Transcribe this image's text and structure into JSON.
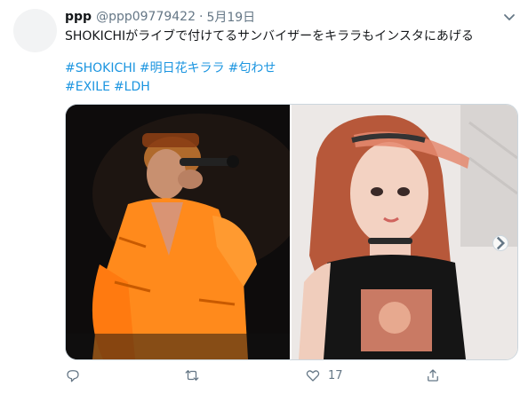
{
  "tweet": {
    "name": "ppp",
    "handle": "@ppp09779422",
    "separator": "·",
    "date": "5月19日",
    "text": "SHOKICHIがライブで付けてるサンバイザーをキララもインスタにあげる",
    "hashtags": [
      "#SHOKICHI",
      "#明日花キララ",
      "#匂わせ",
      "#EXILE",
      "#LDH"
    ]
  },
  "actions": {
    "reply_count": "",
    "retweet_count": "",
    "like_count": "17",
    "share_count": ""
  },
  "icons": [
    "caret-down-icon",
    "reply-icon",
    "retweet-icon",
    "like-icon",
    "share-icon",
    "chevron-right-icon"
  ],
  "colors": {
    "link": "#1b95e0",
    "secondary": "#657786",
    "border": "#ccd6dd",
    "orange_jacket": "#ff8a1c"
  }
}
